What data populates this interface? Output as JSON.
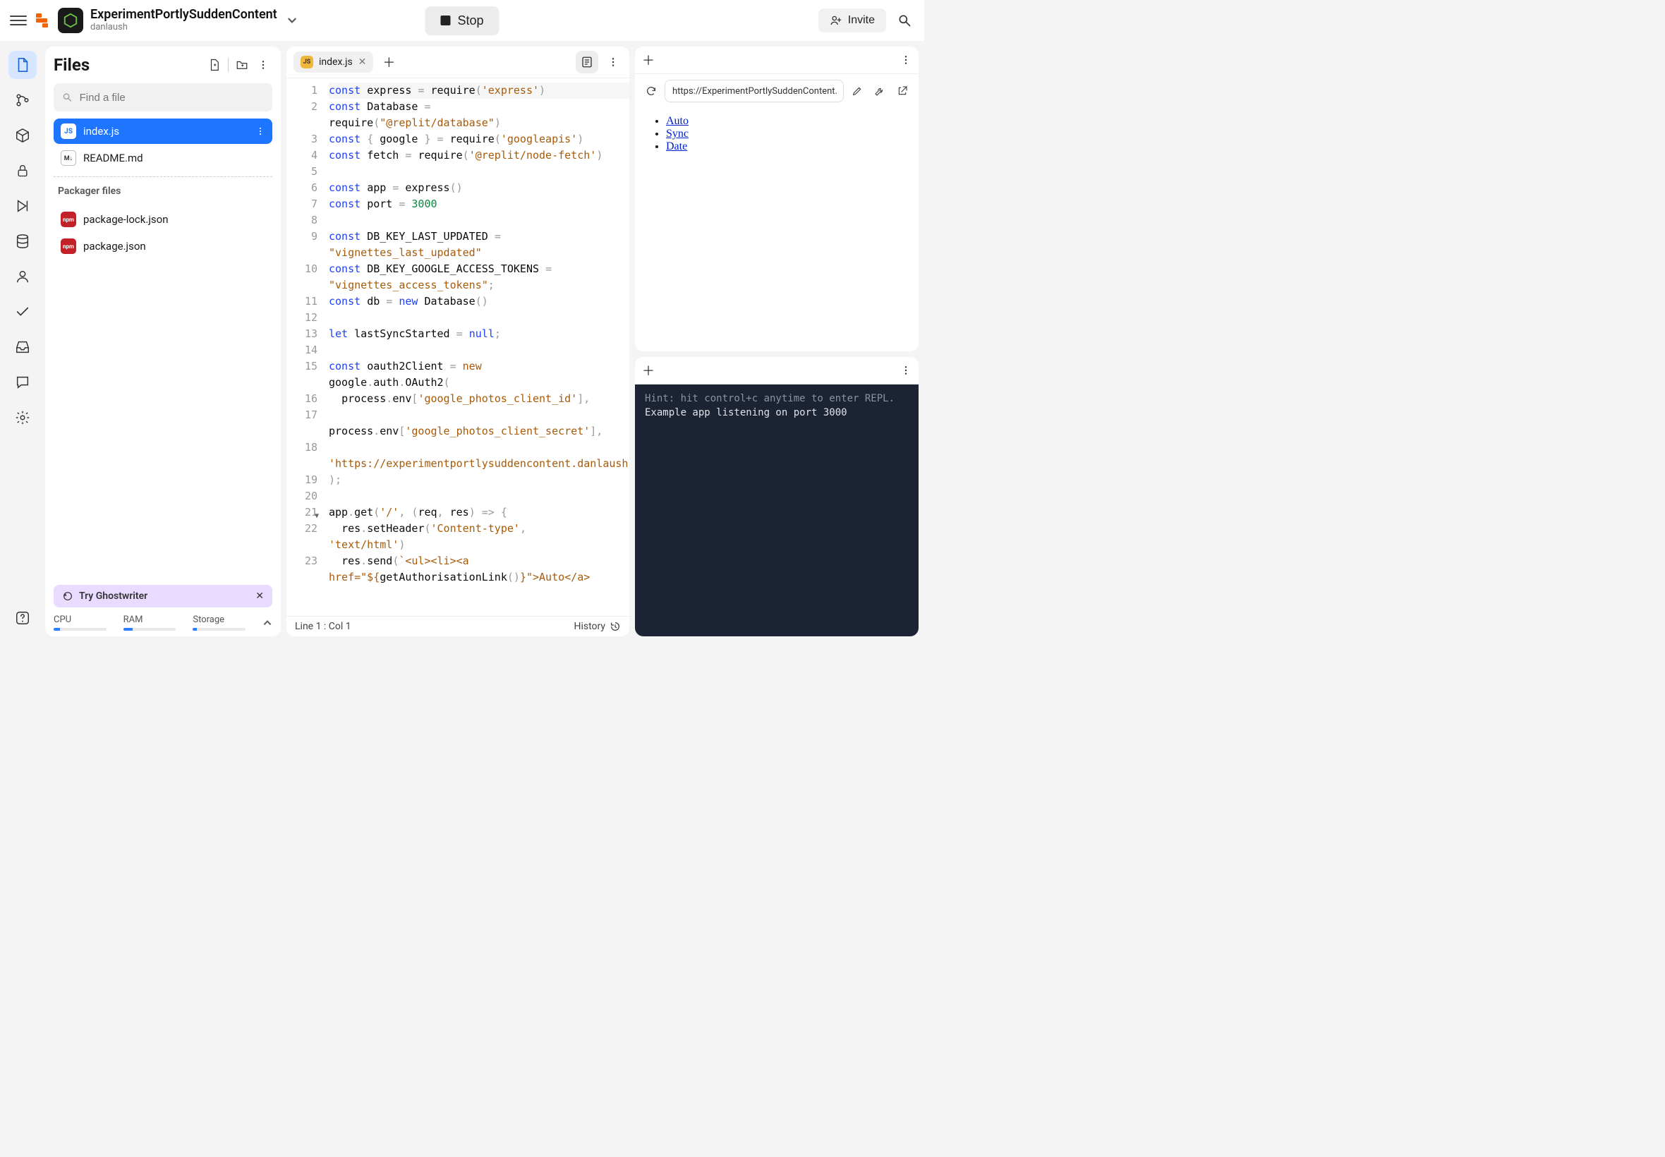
{
  "header": {
    "project_title": "ExperimentPortlySuddenContent",
    "author": "danlaush",
    "stop_label": "Stop",
    "invite_label": "Invite"
  },
  "files": {
    "title": "Files",
    "search_placeholder": "Find a file",
    "items": [
      {
        "name": "index.js",
        "badge": "JS",
        "active": true
      },
      {
        "name": "README.md",
        "badge": "M↓",
        "active": false
      }
    ],
    "packager_label": "Packager files",
    "packager_items": [
      {
        "name": "package-lock.json",
        "badge": "npm"
      },
      {
        "name": "package.json",
        "badge": "npm"
      }
    ],
    "ghostwriter_label": "Try Ghostwriter",
    "stats": {
      "cpu_label": "CPU",
      "cpu_pct": 12,
      "ram_label": "RAM",
      "ram_pct": 18,
      "storage_label": "Storage",
      "storage_pct": 8
    }
  },
  "editor": {
    "tab_filename": "index.js",
    "status_line": "Line 1 : Col 1",
    "history_label": "History",
    "code_tokens": [
      [
        [
          "kw",
          "const"
        ],
        [
          "sp",
          " "
        ],
        [
          "var",
          "express"
        ],
        [
          "sp",
          " "
        ],
        [
          "op",
          "="
        ],
        [
          "sp",
          " "
        ],
        [
          "fn",
          "require"
        ],
        [
          "op",
          "("
        ],
        [
          "str",
          "'express'"
        ],
        [
          "op",
          ")"
        ]
      ],
      [
        [
          "kw",
          "const"
        ],
        [
          "sp",
          " "
        ],
        [
          "var",
          "Database"
        ],
        [
          "sp",
          " "
        ],
        [
          "op",
          "="
        ]
      ],
      [
        [
          "fn",
          "require"
        ],
        [
          "op",
          "("
        ],
        [
          "str",
          "\"@replit/database\""
        ],
        [
          "op",
          ")"
        ]
      ],
      [
        [
          "kw",
          "const"
        ],
        [
          "sp",
          " "
        ],
        [
          "op",
          "{ "
        ],
        [
          "var",
          "google"
        ],
        [
          "op",
          " } "
        ],
        [
          "op",
          "="
        ],
        [
          "sp",
          " "
        ],
        [
          "fn",
          "require"
        ],
        [
          "op",
          "("
        ],
        [
          "str",
          "'googleapis'"
        ],
        [
          "op",
          ")"
        ]
      ],
      [
        [
          "kw",
          "const"
        ],
        [
          "sp",
          " "
        ],
        [
          "var",
          "fetch"
        ],
        [
          "sp",
          " "
        ],
        [
          "op",
          "="
        ],
        [
          "sp",
          " "
        ],
        [
          "fn",
          "require"
        ],
        [
          "op",
          "("
        ],
        [
          "str",
          "'@replit/node-fetch'"
        ],
        [
          "op",
          ")"
        ]
      ],
      [],
      [
        [
          "kw",
          "const"
        ],
        [
          "sp",
          " "
        ],
        [
          "var",
          "app"
        ],
        [
          "sp",
          " "
        ],
        [
          "op",
          "="
        ],
        [
          "sp",
          " "
        ],
        [
          "fn",
          "express"
        ],
        [
          "op",
          "()"
        ]
      ],
      [
        [
          "kw",
          "const"
        ],
        [
          "sp",
          " "
        ],
        [
          "var",
          "port"
        ],
        [
          "sp",
          " "
        ],
        [
          "op",
          "="
        ],
        [
          "sp",
          " "
        ],
        [
          "num",
          "3000"
        ]
      ],
      [],
      [
        [
          "kw",
          "const"
        ],
        [
          "sp",
          " "
        ],
        [
          "var",
          "DB_KEY_LAST_UPDATED"
        ],
        [
          "sp",
          " "
        ],
        [
          "op",
          "="
        ]
      ],
      [
        [
          "str",
          "\"vignettes_last_updated\""
        ]
      ],
      [
        [
          "kw",
          "const"
        ],
        [
          "sp",
          " "
        ],
        [
          "var",
          "DB_KEY_GOOGLE_ACCESS_TOKENS"
        ],
        [
          "sp",
          " "
        ],
        [
          "op",
          "="
        ]
      ],
      [
        [
          "str",
          "\"vignettes_access_tokens\""
        ],
        [
          "op",
          ";"
        ]
      ],
      [
        [
          "kw",
          "const"
        ],
        [
          "sp",
          " "
        ],
        [
          "var",
          "db"
        ],
        [
          "sp",
          " "
        ],
        [
          "op",
          "="
        ],
        [
          "sp",
          " "
        ],
        [
          "kw",
          "new"
        ],
        [
          "sp",
          " "
        ],
        [
          "fn",
          "Database"
        ],
        [
          "op",
          "()"
        ]
      ],
      [],
      [
        [
          "kw",
          "let"
        ],
        [
          "sp",
          " "
        ],
        [
          "var",
          "lastSyncStarted"
        ],
        [
          "sp",
          " "
        ],
        [
          "op",
          "="
        ],
        [
          "sp",
          " "
        ],
        [
          "kw",
          "null"
        ],
        [
          "op",
          ";"
        ]
      ],
      [],
      [
        [
          "kw",
          "const"
        ],
        [
          "sp",
          " "
        ],
        [
          "var",
          "oauth2Client"
        ],
        [
          "sp",
          " "
        ],
        [
          "op",
          "="
        ],
        [
          "sp",
          " "
        ],
        [
          "new",
          "new"
        ]
      ],
      [
        [
          "var",
          "google"
        ],
        [
          "op",
          "."
        ],
        [
          "var",
          "auth"
        ],
        [
          "op",
          "."
        ],
        [
          "fn",
          "OAuth2"
        ],
        [
          "op",
          "("
        ]
      ],
      [
        [
          "sp",
          "  "
        ],
        [
          "var",
          "process"
        ],
        [
          "op",
          "."
        ],
        [
          "var",
          "env"
        ],
        [
          "op",
          "["
        ],
        [
          "str",
          "'google_photos_client_id'"
        ],
        [
          "op",
          "],"
        ]
      ],
      [],
      [
        [
          "var",
          "process"
        ],
        [
          "op",
          "."
        ],
        [
          "var",
          "env"
        ],
        [
          "op",
          "["
        ],
        [
          "str",
          "'google_photos_client_secret'"
        ],
        [
          "op",
          "],"
        ]
      ],
      [],
      [
        [
          "str",
          "'https://experimentportlysuddencontent.danlaush.repl.co/auto/callback'"
        ],
        [
          "op",
          ","
        ]
      ],
      [
        [
          "op",
          ");"
        ]
      ],
      [],
      [
        [
          "var",
          "app"
        ],
        [
          "op",
          "."
        ],
        [
          "fn",
          "get"
        ],
        [
          "op",
          "("
        ],
        [
          "str",
          "'/'"
        ],
        [
          "op",
          ", "
        ],
        [
          "op",
          "("
        ],
        [
          "var",
          "req"
        ],
        [
          "op",
          ", "
        ],
        [
          "var",
          "res"
        ],
        [
          "op",
          ")"
        ],
        [
          "sp",
          " "
        ],
        [
          "op",
          "=>"
        ],
        [
          "sp",
          " "
        ],
        [
          "op",
          "{"
        ]
      ],
      [
        [
          "sp",
          "  "
        ],
        [
          "var",
          "res"
        ],
        [
          "op",
          "."
        ],
        [
          "fn",
          "setHeader"
        ],
        [
          "op",
          "("
        ],
        [
          "str",
          "'Content-type'"
        ],
        [
          "op",
          ","
        ]
      ],
      [
        [
          "str",
          "'text/html'"
        ],
        [
          "op",
          ")"
        ]
      ],
      [
        [
          "sp",
          "  "
        ],
        [
          "var",
          "res"
        ],
        [
          "op",
          "."
        ],
        [
          "fn",
          "send"
        ],
        [
          "op",
          "("
        ],
        [
          "str",
          "`<ul><li><a "
        ]
      ],
      [
        [
          "str",
          "href=\"${"
        ],
        [
          "fn",
          "getAuthorisationLink"
        ],
        [
          "op",
          "()"
        ],
        [
          "str",
          "}\">Auto</a>"
        ]
      ]
    ],
    "gutter_numbers": [
      "1",
      "2",
      "",
      "3",
      "4",
      "5",
      "6",
      "7",
      "8",
      "9",
      "",
      "10",
      "",
      "11",
      "12",
      "13",
      "14",
      "15",
      "",
      "16",
      "17",
      "",
      "18",
      "",
      "19",
      "20",
      "21",
      "22",
      "",
      "23",
      ""
    ],
    "fold_at": 26
  },
  "webview": {
    "url": "https://ExperimentPortlySuddenContent.",
    "links": [
      "Auto",
      "Sync",
      "Date"
    ]
  },
  "console": {
    "hint": "Hint: hit control+c anytime to enter REPL.",
    "line2": "Example app listening on port 3000"
  }
}
